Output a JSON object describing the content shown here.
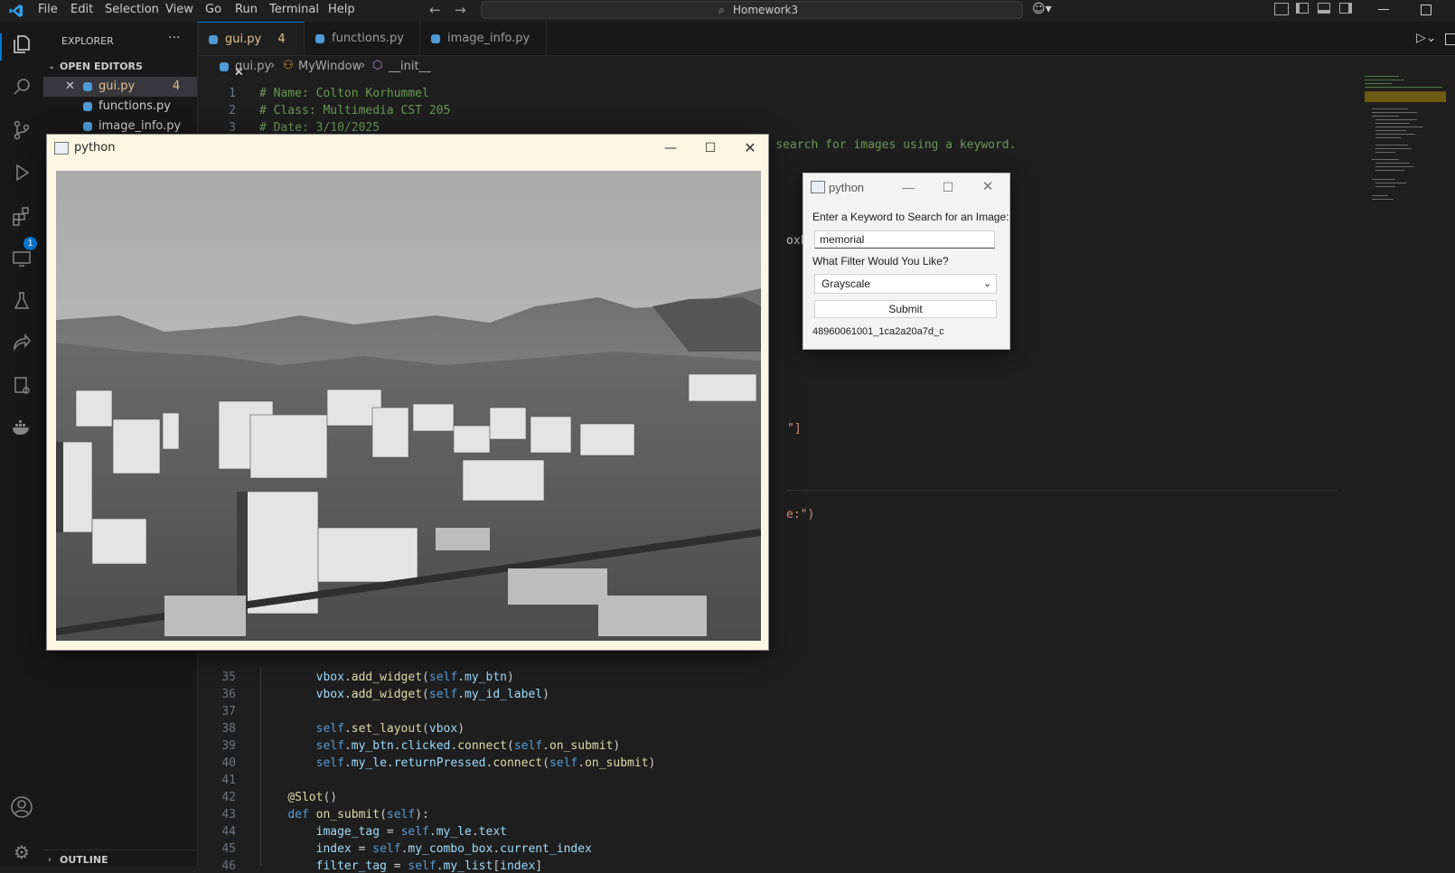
{
  "menu": [
    "File",
    "Edit",
    "Selection",
    "View",
    "Go",
    "Run",
    "Terminal",
    "Help"
  ],
  "search_box": "Homework3",
  "sidebar": {
    "title": "EXPLORER",
    "open_editors_label": "OPEN EDITORS",
    "files": [
      {
        "name": "gui.py",
        "badge": "4",
        "active": true
      },
      {
        "name": "functions.py",
        "badge": "",
        "active": false
      },
      {
        "name": "image_info.py",
        "badge": "",
        "active": false
      }
    ],
    "outline_label": "OUTLINE"
  },
  "tabs": [
    {
      "label": "gui.py",
      "badge": "4",
      "active": true
    },
    {
      "label": "functions.py",
      "badge": "",
      "active": false
    },
    {
      "label": "image_info.py",
      "badge": "",
      "active": false
    }
  ],
  "breadcrumb": [
    "gui.py",
    "MyWindow",
    "__init__"
  ],
  "extensions_badge": "1",
  "code_top": [
    {
      "n": "1",
      "text": "# Name: Colton Korhummel"
    },
    {
      "n": "2",
      "text": "# Class: Multimedia CST 205"
    },
    {
      "n": "3",
      "text": "# Date: 3/10/2025"
    },
    {
      "n": "4",
      "text": "# Description: This file is used for making GUI that allows the users to search for images using a keyword."
    }
  ],
  "code_fragments": {
    "oxl": "oxL",
    "bracket": "\"]",
    "le": "e:\")"
  },
  "code_bottom": [
    {
      "n": "35",
      "html": "        <span class='var'>vbox</span>.<span class='fn'>add_widget</span>(<span class='self'>self</span>.<span class='var'>my_btn</span>)"
    },
    {
      "n": "36",
      "html": "        <span class='var'>vbox</span>.<span class='fn'>add_widget</span>(<span class='self'>self</span>.<span class='var'>my_id_label</span>)"
    },
    {
      "n": "37",
      "html": ""
    },
    {
      "n": "38",
      "html": "        <span class='self'>self</span>.<span class='fn'>set_layout</span>(<span class='var'>vbox</span>)"
    },
    {
      "n": "39",
      "html": "        <span class='self'>self</span>.<span class='var'>my_btn</span>.<span class='var'>clicked</span>.<span class='fn'>connect</span>(<span class='self'>self</span>.<span class='fn'>on_submit</span>)"
    },
    {
      "n": "40",
      "html": "        <span class='self'>self</span>.<span class='var'>my_le</span>.<span class='var'>returnPressed</span>.<span class='fn'>connect</span>(<span class='self'>self</span>.<span class='fn'>on_submit</span>)"
    },
    {
      "n": "41",
      "html": ""
    },
    {
      "n": "42",
      "html": "    <span class='dec'>@Slot</span>()"
    },
    {
      "n": "43",
      "html": "    <span class='kw'>def</span> <span class='fn'>on_submit</span>(<span class='self'>self</span>):"
    },
    {
      "n": "44",
      "html": "        <span class='var'>image_tag</span> = <span class='self'>self</span>.<span class='var'>my_le</span>.<span class='var'>text</span>"
    },
    {
      "n": "45",
      "html": "        <span class='var'>index</span> = <span class='self'>self</span>.<span class='var'>my_combo_box</span>.<span class='var'>current_index</span>"
    },
    {
      "n": "46",
      "html": "        <span class='var'>filter_tag</span> = <span class='self'>self</span>.<span class='var'>my_list</span>[<span class='var'>index</span>]"
    }
  ],
  "image_window": {
    "title": "python"
  },
  "search_window": {
    "title": "python",
    "prompt": "Enter a Keyword to Search for an Image:",
    "keyword_value": "memorial",
    "filter_prompt": "What Filter Would You Like?",
    "filter_selected": "Grayscale",
    "submit_label": "Submit",
    "result_id": "48960061001_1ca2a20a7d_c"
  }
}
